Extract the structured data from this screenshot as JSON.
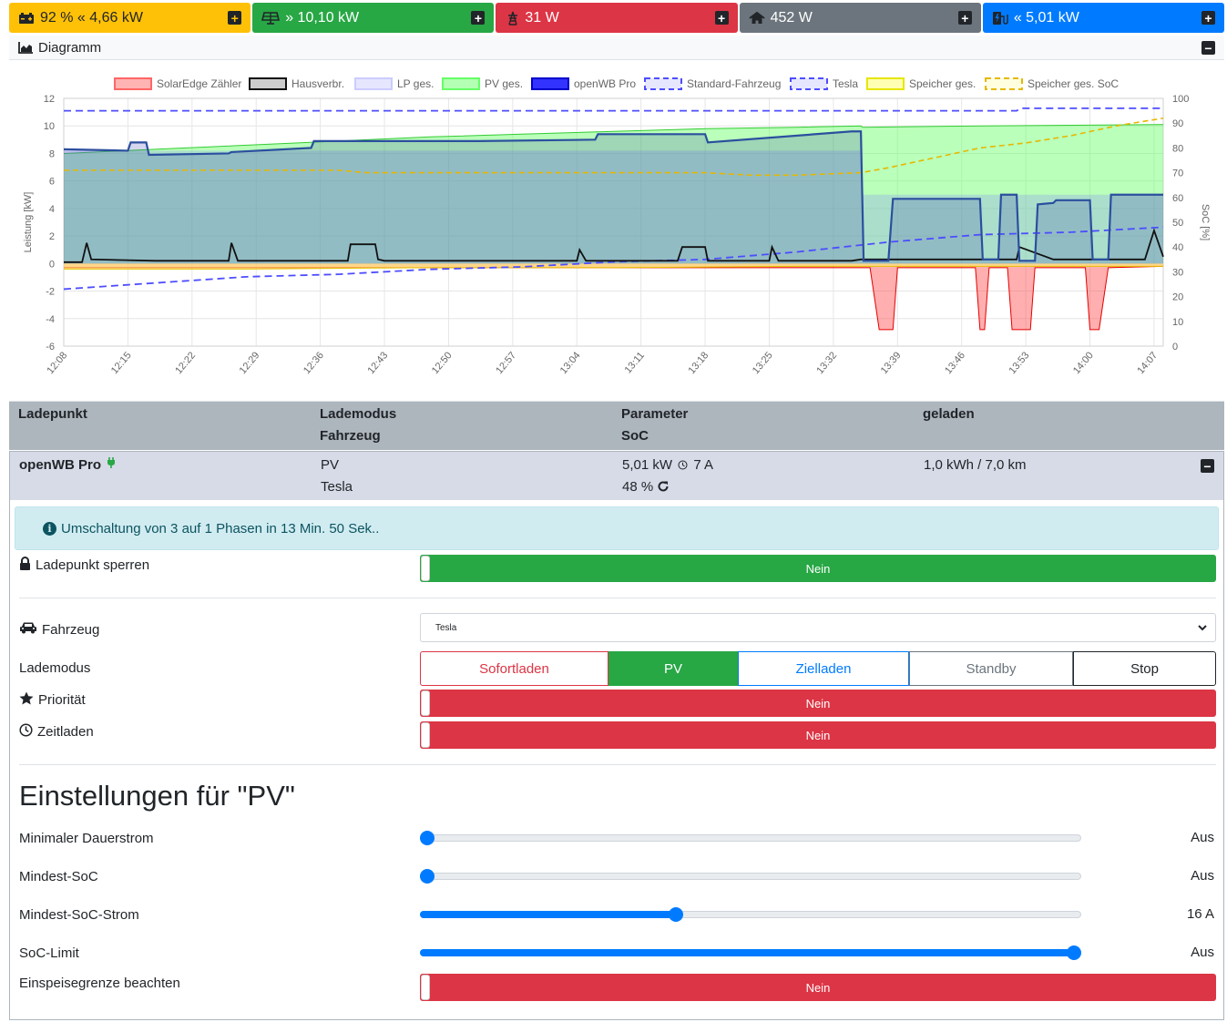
{
  "tiles": [
    {
      "name": "speicher",
      "text": "92 % « 4,66 kW",
      "icon": "battery-car-icon",
      "color": "#ffc107"
    },
    {
      "name": "pv",
      "text": "» 10,10 kW",
      "icon": "solar-panel-icon",
      "color": "#28a745"
    },
    {
      "name": "netz",
      "text": "31 W",
      "icon": "power-pylon-icon",
      "color": "#dc3545"
    },
    {
      "name": "haus",
      "text": "452 W",
      "icon": "house-icon",
      "color": "#6c757d"
    },
    {
      "name": "ladepunkt",
      "text": "« 5,01 kW",
      "icon": "charging-station-icon",
      "color": "#007bff"
    }
  ],
  "diagram": {
    "title": "Diagramm",
    "chart_data": {
      "type": "area",
      "legend_position": "top",
      "legend": [
        "SolarEdge Zähler",
        "Hausverbr.",
        "LP ges.",
        "PV ges.",
        "openWB Pro",
        "Standard-Fahrzeug",
        "Tesla",
        "Speicher ges.",
        "Speicher ges. SoC"
      ],
      "ylabel": "Leistung [kW]",
      "y2label": "SoC [%]",
      "ylim": [
        -6,
        12
      ],
      "y2lim": [
        0,
        100
      ],
      "yticks": [
        12,
        10,
        8,
        6,
        4,
        2,
        0,
        -2,
        -4,
        -6
      ],
      "y2ticks": [
        100,
        90,
        80,
        70,
        60,
        50,
        40,
        30,
        20,
        10,
        0
      ],
      "xticks": [
        "12:08",
        "12:15",
        "12:22",
        "12:29",
        "12:36",
        "12:43",
        "12:50",
        "12:57",
        "13:04",
        "13:11",
        "13:18",
        "13:25",
        "13:32",
        "13:39",
        "13:46",
        "13:53",
        "14:00",
        "14:07"
      ],
      "x_minutes": [
        0,
        7,
        14,
        21,
        28,
        35,
        42,
        49,
        56,
        63,
        70,
        77,
        84,
        91,
        98,
        105,
        112,
        119
      ],
      "xlim_minutes": [
        0,
        120
      ],
      "series": [
        {
          "name": "PV ges.",
          "x": [
            0,
            10,
            20,
            30,
            40,
            50,
            60,
            70,
            80,
            87,
            87.2,
            100,
            110,
            120
          ],
          "y": [
            8.0,
            8.3,
            8.6,
            8.9,
            9.2,
            9.4,
            9.6,
            9.8,
            9.9,
            10.0,
            9.9,
            10.0,
            10.05,
            10.1
          ],
          "color": "#00e600"
        },
        {
          "name": "LP ges.",
          "x": [
            0,
            87,
            87.2,
            120
          ],
          "y": [
            8.2,
            8.2,
            5.0,
            5.0
          ],
          "color": "#b3b3ff"
        },
        {
          "name": "openWB Pro",
          "x": [
            0,
            7,
            7.3,
            9,
            9.3,
            18,
            18.3,
            27,
            27.3,
            35,
            35.3,
            45,
            45.3,
            58,
            58.3,
            70,
            70.3,
            86,
            86.4,
            87,
            87.3,
            90,
            90.5,
            100,
            100.3,
            102,
            102.3,
            104,
            104.3,
            106,
            106.3,
            108,
            108.3,
            112,
            112.3,
            114,
            114.3,
            120
          ],
          "y": [
            8.3,
            8.2,
            8.8,
            8.8,
            7.9,
            8.0,
            8.1,
            8.4,
            8.9,
            8.9,
            8.9,
            8.9,
            8.9,
            9.0,
            9.4,
            9.4,
            8.8,
            9.6,
            9.6,
            9.6,
            0.2,
            0.2,
            4.7,
            4.7,
            0.3,
            0.3,
            5.0,
            5.0,
            0.2,
            0.2,
            4.3,
            4.4,
            4.6,
            4.6,
            0.3,
            0.3,
            5.0,
            5.0
          ],
          "color": "#0000ff"
        },
        {
          "name": "Hausverbr.",
          "x": [
            0,
            2,
            2.5,
            3,
            10,
            18,
            18.3,
            19,
            30,
            31,
            31.3,
            34,
            34.3,
            35,
            45,
            56,
            56.3,
            57,
            67,
            67.5,
            70,
            70.3,
            77,
            77.3,
            78,
            86,
            87,
            88,
            92,
            94,
            100,
            104,
            104.3,
            108,
            110,
            114,
            118,
            119,
            120
          ],
          "y": [
            0.1,
            0.1,
            1.5,
            0.3,
            0.2,
            0.2,
            1.5,
            0.2,
            0.2,
            0.2,
            1.4,
            1.4,
            0.3,
            0.2,
            0.2,
            0.2,
            1.0,
            0.2,
            0.2,
            1.2,
            1.2,
            0.2,
            0.2,
            1.2,
            0.2,
            0.2,
            0.3,
            0.3,
            0.3,
            0.3,
            0.3,
            0.3,
            1.2,
            0.3,
            0.3,
            0.3,
            0.3,
            2.4,
            0.5
          ],
          "color": "#000000"
        },
        {
          "name": "SolarEdge Zähler",
          "x": [
            0,
            87,
            87.2,
            88,
            89,
            89.5,
            90.5,
            91,
            99.5,
            100,
            100.5,
            101,
            103,
            103.5,
            104,
            105.5,
            106,
            111.5,
            112,
            113,
            114,
            120
          ],
          "y": [
            -0.3,
            -0.3,
            -0.3,
            -0.3,
            -4.8,
            -4.8,
            -4.8,
            -0.3,
            -0.3,
            -4.8,
            -4.8,
            -0.3,
            -0.3,
            -4.8,
            -4.8,
            -4.8,
            -0.3,
            -0.3,
            -4.8,
            -4.8,
            -0.3,
            -0.2
          ],
          "color": "#ff0000"
        },
        {
          "name": "Speicher ges.",
          "x": [
            0,
            20,
            40,
            60,
            80,
            87,
            100,
            110,
            120
          ],
          "y": [
            -0.4,
            -0.4,
            -0.3,
            -0.3,
            -0.2,
            -0.2,
            -0.2,
            -0.2,
            -0.2
          ],
          "color": "#e6e600"
        },
        {
          "name": "Speicher ges. SoC",
          "x": [
            0,
            30,
            33,
            40,
            60,
            70,
            75,
            80,
            87,
            90,
            95,
            100,
            105,
            110,
            115,
            120
          ],
          "y2": [
            71,
            71,
            70,
            70,
            70,
            70,
            69,
            69,
            70,
            72,
            76,
            80,
            82,
            85,
            89,
            92
          ],
          "color": "#e6b800"
        },
        {
          "name": "Standard-Fahrzeug",
          "x": [
            0,
            4,
            8,
            12,
            20,
            30,
            40,
            50,
            60,
            70,
            80,
            85,
            90,
            100,
            110,
            115,
            120
          ],
          "y2": [
            23,
            24,
            25,
            26,
            28,
            29,
            31,
            32,
            34,
            35,
            38,
            40,
            42,
            45,
            46,
            47,
            48
          ],
          "color": "#5555ff"
        },
        {
          "name": "Tesla",
          "x": [
            0,
            104,
            104.5,
            120
          ],
          "y2": [
            95,
            95,
            96,
            96
          ],
          "color": "#5555ff"
        }
      ]
    }
  },
  "ladepunkt_table": {
    "headers": {
      "col1": "Ladepunkt",
      "col2a": "Lademodus",
      "col2b": "Fahrzeug",
      "col3a": "Parameter",
      "col3b": "SoC",
      "col4": "geladen"
    },
    "row": {
      "name": "openWB Pro",
      "mode": "PV",
      "vehicle": "Tesla",
      "param": "5,01 kW",
      "current": "7 A",
      "soc": "48 %",
      "charged": "1,0 kWh / 7,0 km"
    }
  },
  "details": {
    "info": "Umschaltung von 3 auf 1 Phasen in 13 Min. 50 Sek..",
    "lock_label": "Ladepunkt sperren",
    "lock_value": "Nein",
    "vehicle_label": "Fahrzeug",
    "vehicle_selected": "Tesla",
    "mode_label": "Lademodus",
    "modes": [
      "Sofortladen",
      "PV",
      "Zielladen",
      "Standby",
      "Stop"
    ],
    "priority_label": "Priorität",
    "priority_value": "Nein",
    "timed_label": "Zeitladen",
    "timed_value": "Nein",
    "settings_title": "Einstellungen für \"PV\"",
    "sliders": [
      {
        "label": "Minimaler Dauerstrom",
        "value": "Aus",
        "fraction": 0.0
      },
      {
        "label": "Mindest-SoC",
        "value": "Aus",
        "fraction": 0.0
      },
      {
        "label": "Mindest-SoC-Strom",
        "value": "16 A",
        "fraction": 0.385
      },
      {
        "label": "SoC-Limit",
        "value": "Aus",
        "fraction": 1.0
      }
    ],
    "feedin_label": "Einspeisegrenze beachten",
    "feedin_value": "Nein"
  }
}
